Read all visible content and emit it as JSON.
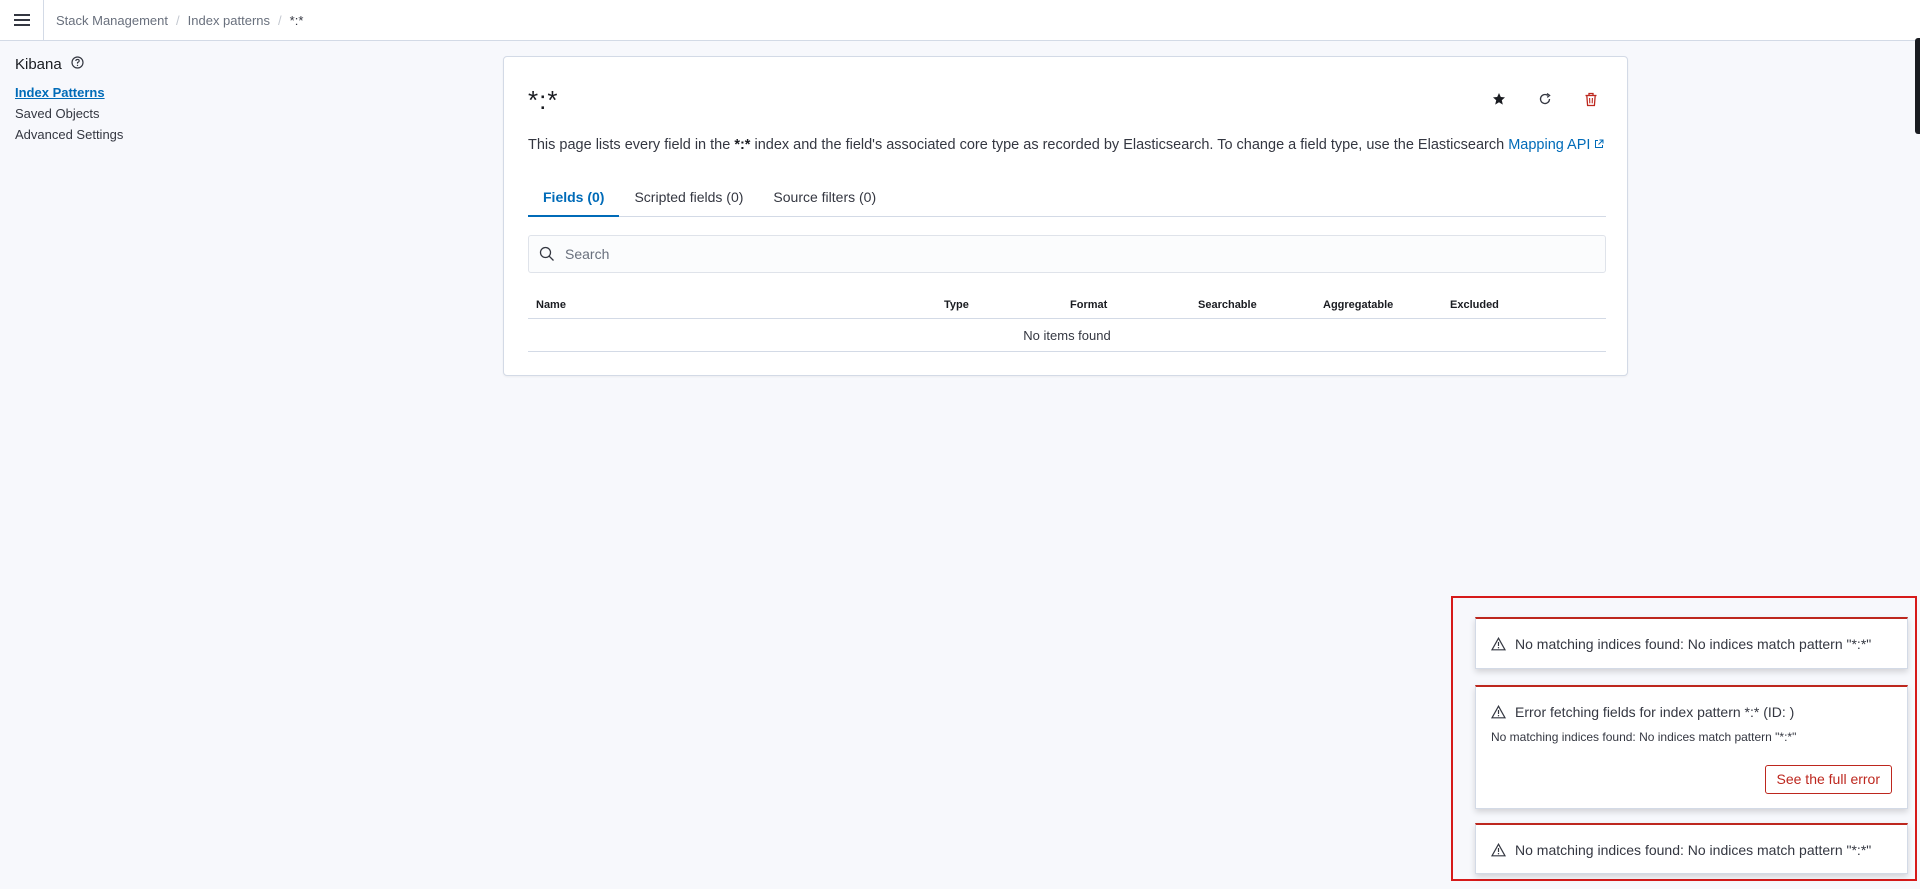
{
  "header": {
    "breadcrumbs": [
      "Stack Management",
      "Index patterns",
      "*:*"
    ]
  },
  "sidebar": {
    "title": "Kibana",
    "items": [
      {
        "label": "Index Patterns",
        "active": true
      },
      {
        "label": "Saved Objects",
        "active": false
      },
      {
        "label": "Advanced Settings",
        "active": false
      }
    ]
  },
  "main": {
    "pattern_title": "*:*",
    "description": {
      "before": "This page lists every field in the ",
      "pattern": "*:*",
      "after": " index and the field's associated core type as recorded by Elasticsearch. To change a field type, use the Elasticsearch ",
      "link": "Mapping API"
    },
    "tabs": [
      {
        "label": "Fields (0)",
        "active": true
      },
      {
        "label": "Scripted fields (0)",
        "active": false
      },
      {
        "label": "Source filters (0)",
        "active": false
      }
    ],
    "search": {
      "placeholder": "Search",
      "value": ""
    },
    "table": {
      "columns": [
        "Name",
        "Type",
        "Format",
        "Searchable",
        "Aggregatable",
        "Excluded"
      ],
      "empty_message": "No items found"
    }
  },
  "toasts": [
    {
      "title": "No matching indices found: No indices match pattern \"*:*\""
    },
    {
      "title": "Error fetching fields for index pattern *:* (ID: )",
      "body": "No matching indices found: No indices match pattern \"*:*\"",
      "button": "See the full error"
    },
    {
      "title": "No matching indices found: No indices match pattern \"*:*\""
    }
  ],
  "colors": {
    "accent": "#006bb8",
    "danger": "#bd271e",
    "highlight_border": "#d61a1a"
  },
  "icons": [
    "menu-icon",
    "help-icon",
    "star-icon",
    "refresh-icon",
    "trash-icon",
    "external-link-icon",
    "search-icon",
    "warning-icon"
  ]
}
